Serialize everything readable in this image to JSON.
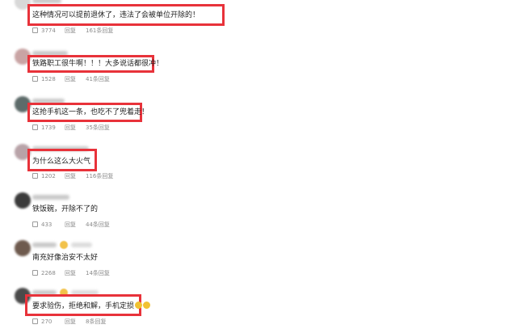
{
  "comments": [
    {
      "text": "这种情况可以提前退休了，违法了会被单位开除的！",
      "likes": "3774",
      "reply_label": "回复",
      "replies": "161条回复",
      "avatar_color": "#d8d8d8"
    },
    {
      "text": "铁路职工很牛啊！！！大多说话都很冲！",
      "likes": "1528",
      "reply_label": "回复",
      "replies": "41条回复",
      "avatar_color": "#c9a4a4"
    },
    {
      "text": "这抢手机这一条，也吃不了兜着走！",
      "likes": "1739",
      "reply_label": "回复",
      "replies": "35条回复",
      "avatar_color": "#5d6b6a"
    },
    {
      "text": "为什么这么大火气",
      "likes": "1202",
      "reply_label": "回复",
      "replies": "116条回复",
      "avatar_color": "#b8a3a8"
    },
    {
      "text": "铁饭碗，开除不了的",
      "likes": "433",
      "reply_label": "回复",
      "replies": "44条回复",
      "avatar_color": "#3b3b3b"
    },
    {
      "text": "南充好像治安不太好",
      "likes": "2268",
      "reply_label": "回复",
      "replies": "14条回复",
      "avatar_color": "#6e5a4e"
    },
    {
      "text": "要求验伤，拒绝和解，手机定损",
      "likes": "270",
      "reply_label": "回复",
      "replies": "8条回复",
      "avatar_color": "#4a4a4a"
    }
  ],
  "icons": {
    "like": "thumbs-up-icon",
    "emoji": "emoji-icon"
  },
  "colors": {
    "highlight": "#e8323a"
  }
}
